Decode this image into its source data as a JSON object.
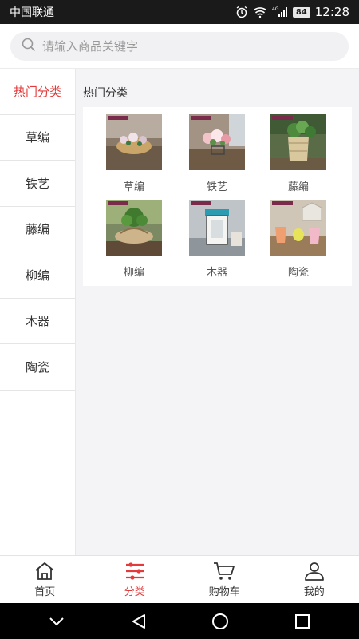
{
  "status_bar": {
    "carrier": "中国联通",
    "network_tag": "4G",
    "battery": "84",
    "time": "12:28"
  },
  "search": {
    "placeholder": "请输入商品关键字"
  },
  "sidebar": {
    "items": [
      {
        "label": "热门分类",
        "active": true
      },
      {
        "label": "草编"
      },
      {
        "label": "铁艺"
      },
      {
        "label": "藤编"
      },
      {
        "label": "柳编"
      },
      {
        "label": "木器"
      },
      {
        "label": "陶瓷"
      }
    ]
  },
  "main": {
    "section_title": "热门分类",
    "categories": [
      {
        "label": "草编"
      },
      {
        "label": "铁艺"
      },
      {
        "label": "藤编"
      },
      {
        "label": "柳编"
      },
      {
        "label": "木器"
      },
      {
        "label": "陶瓷"
      }
    ]
  },
  "tabbar": {
    "tabs": [
      {
        "label": "首页",
        "icon": "home-icon"
      },
      {
        "label": "分类",
        "icon": "category-icon",
        "active": true
      },
      {
        "label": "购物车",
        "icon": "cart-icon"
      },
      {
        "label": "我的",
        "icon": "user-icon"
      }
    ]
  },
  "colors": {
    "accent": "#e33b3b",
    "background": "#f4f4f6",
    "status_bar": "#1a1a1a"
  }
}
